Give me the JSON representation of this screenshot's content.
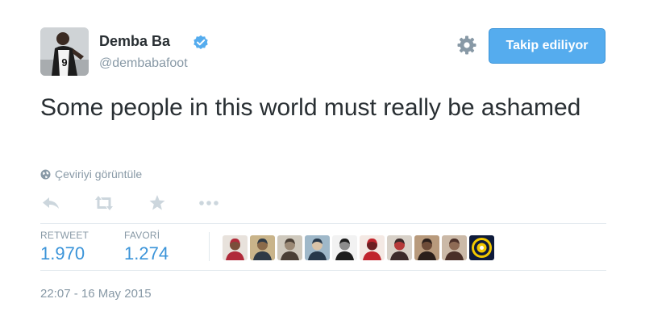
{
  "user": {
    "name": "Demba Ba",
    "handle": "@dembabafoot",
    "verified": true,
    "avatar_jersey_number": "9"
  },
  "follow_button": {
    "label": "Takip ediliyor"
  },
  "tweet": {
    "text": "Some people in this world must really be ashamed",
    "translate_label": "Çeviriyi görüntüle",
    "timestamp": "22:07 - 16 May 2015"
  },
  "actions": [
    {
      "name": "reply-icon"
    },
    {
      "name": "retweet-icon"
    },
    {
      "name": "favorite-star-icon"
    },
    {
      "name": "more-options-icon"
    }
  ],
  "stats": {
    "retweet_label": "RETWEET",
    "retweet_count": "1.970",
    "favorite_label": "FAVORİ",
    "favorite_count": "1.274"
  },
  "favoriters": [
    {
      "name": "favoriter-avatar-1",
      "colors": [
        "#e8e2dc",
        "#b02a3a",
        "#7a4e3a"
      ]
    },
    {
      "name": "favoriter-avatar-2",
      "colors": [
        "#c9b48a",
        "#2e3a46",
        "#8a6a4a"
      ]
    },
    {
      "name": "favoriter-avatar-3",
      "colors": [
        "#cfc9bd",
        "#4a3f35",
        "#9c8a76"
      ]
    },
    {
      "name": "favoriter-avatar-4",
      "colors": [
        "#9fb8c9",
        "#27384a",
        "#d9c3a8"
      ]
    },
    {
      "name": "favoriter-avatar-5",
      "colors": [
        "#f2f2f2",
        "#1d1d1d",
        "#8c8c8c"
      ]
    },
    {
      "name": "favoriter-avatar-6",
      "colors": [
        "#f4e9e4",
        "#c0242d",
        "#6d1f22"
      ]
    },
    {
      "name": "favoriter-avatar-7",
      "colors": [
        "#d8d1c8",
        "#3b2a2a",
        "#b63a3a"
      ]
    },
    {
      "name": "favoriter-avatar-8",
      "colors": [
        "#b89a7c",
        "#2b1f1a",
        "#6e4c38"
      ]
    },
    {
      "name": "favoriter-avatar-9",
      "colors": [
        "#cbb9a7",
        "#4a2f28",
        "#8e6b55"
      ]
    },
    {
      "name": "favoriter-avatar-10",
      "colors": [
        "#0e1a3a",
        "#f2c800",
        "#ffffff"
      ]
    }
  ],
  "colors": {
    "accent": "#55acee",
    "stat_value": "#3b94d9",
    "muted_text": "#8899a6",
    "main_text": "#292f33"
  }
}
